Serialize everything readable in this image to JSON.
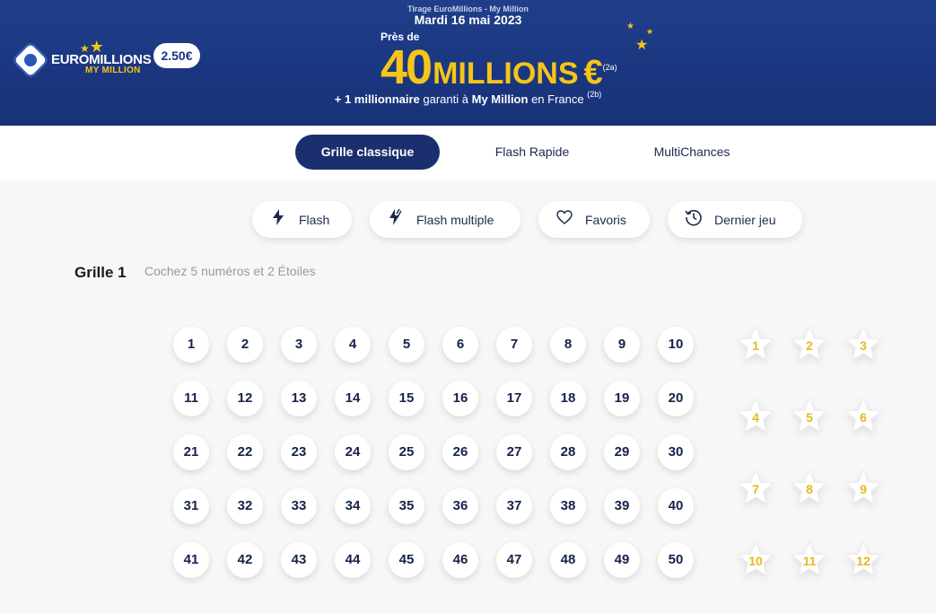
{
  "header": {
    "logo_text": "EUROMILLIONS",
    "logo_sub": "MY MILLION",
    "price": "2.50€",
    "tirage": "Tirage EuroMillions - My Million",
    "date": "Mardi 16 mai 2023",
    "pres_de": "Près de",
    "jackpot_amount": "40",
    "jackpot_unit": "MILLIONS",
    "jackpot_currency": "€",
    "jackpot_note": "(2a)",
    "subline_prefix": "+ 1 millionnaire",
    "subline_mid": " garanti à ",
    "subline_brand": "My Million",
    "subline_suffix": " en France ",
    "subline_note": "(2b)"
  },
  "tabs": [
    {
      "label": "Grille classique",
      "active": true
    },
    {
      "label": "Flash Rapide",
      "active": false
    },
    {
      "label": "MultiChances",
      "active": false
    }
  ],
  "actions": [
    {
      "label": "Flash",
      "icon": "flash-icon"
    },
    {
      "label": "Flash multiple",
      "icon": "flash-multiple-icon"
    },
    {
      "label": "Favoris",
      "icon": "heart-icon"
    },
    {
      "label": "Dernier jeu",
      "icon": "history-icon"
    }
  ],
  "grid": {
    "title": "Grille 1",
    "hint": "Cochez 5 numéros et 2 Étoiles",
    "numbers": [
      "1",
      "2",
      "3",
      "4",
      "5",
      "6",
      "7",
      "8",
      "9",
      "10",
      "11",
      "12",
      "13",
      "14",
      "15",
      "16",
      "17",
      "18",
      "19",
      "20",
      "21",
      "22",
      "23",
      "24",
      "25",
      "26",
      "27",
      "28",
      "29",
      "30",
      "31",
      "32",
      "33",
      "34",
      "35",
      "36",
      "37",
      "38",
      "39",
      "40",
      "41",
      "42",
      "43",
      "44",
      "45",
      "46",
      "47",
      "48",
      "49",
      "50"
    ],
    "stars": [
      "1",
      "2",
      "3",
      "4",
      "5",
      "6",
      "7",
      "8",
      "9",
      "10",
      "11",
      "12"
    ]
  },
  "colors": {
    "banner": "#1b3680",
    "accent_yellow": "#f5c518",
    "active_tab": "#1b2f6e",
    "star_number": "#e6b81f"
  }
}
